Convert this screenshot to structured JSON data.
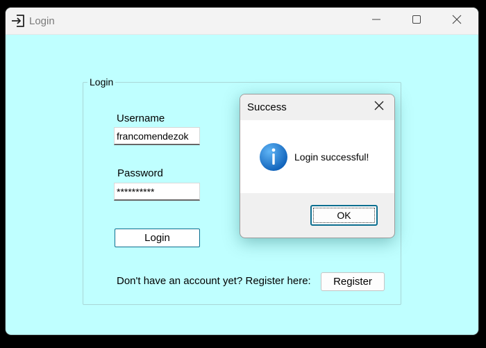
{
  "window": {
    "title": "Login",
    "icon": "login-arrow-icon",
    "controls": [
      "minimize-icon",
      "maximize-icon",
      "close-icon"
    ],
    "background": "#bfffff"
  },
  "login_group": {
    "legend": "Login",
    "username_label": "Username",
    "username_value": "francomendezok",
    "password_label": "Password",
    "password_value": "**********",
    "login_button": "Login",
    "register_prompt": "Don't have an account yet? Register here:",
    "register_button": "Register"
  },
  "dialog": {
    "title": "Success",
    "icon": "info-icon",
    "message": "Login successful!",
    "ok_button": "OK",
    "accent": "#1a73c8"
  }
}
